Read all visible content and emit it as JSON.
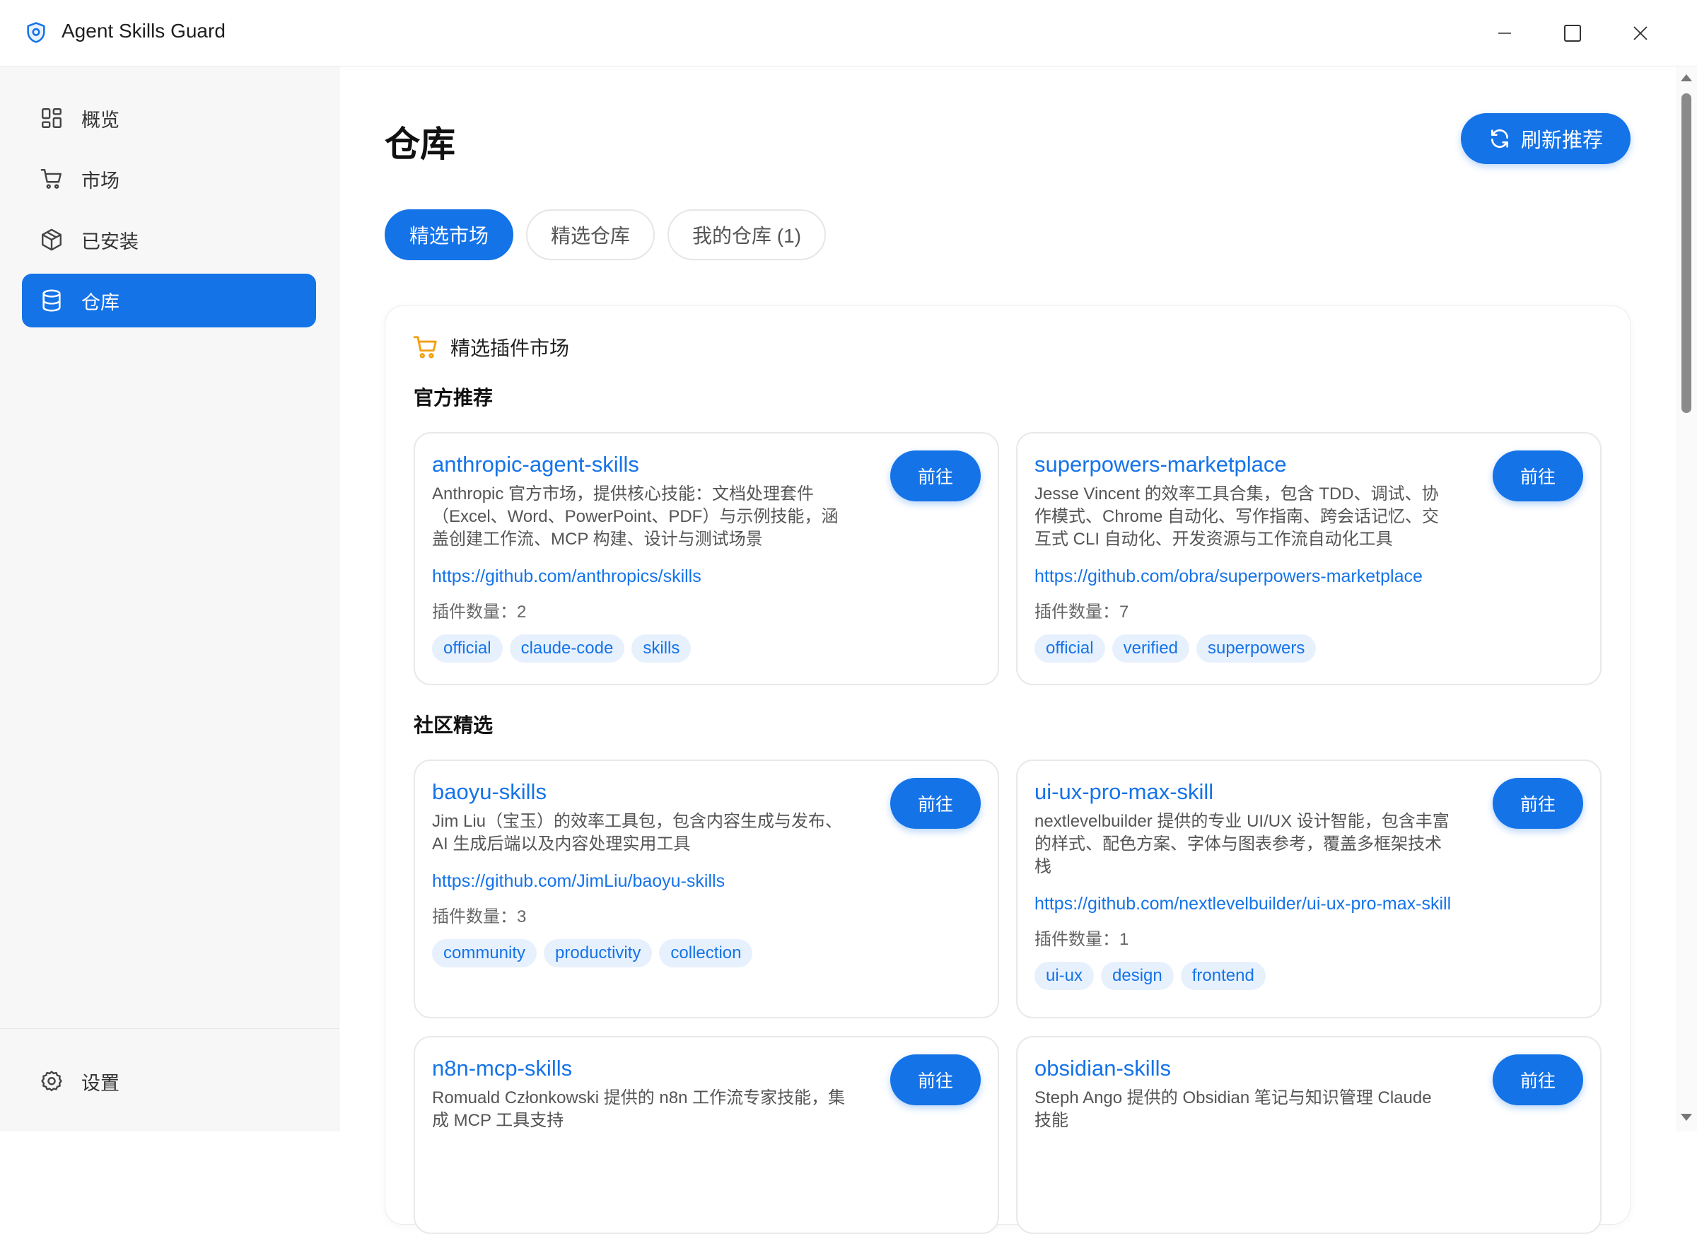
{
  "window": {
    "title": "Agent Skills Guard",
    "controls": [
      "minimize",
      "maximize",
      "close"
    ]
  },
  "sidebar": {
    "items": [
      {
        "label": "概览",
        "icon": "grid-icon"
      },
      {
        "label": "市场",
        "icon": "cart-icon"
      },
      {
        "label": "已安装",
        "icon": "package-icon"
      },
      {
        "label": "仓库",
        "icon": "database-icon",
        "active": true
      }
    ],
    "settings_label": "设置"
  },
  "page": {
    "title": "仓库",
    "refresh_label": "刷新推荐",
    "tabs": [
      {
        "label": "精选市场",
        "active": true
      },
      {
        "label": "精选仓库"
      },
      {
        "label": "我的仓库 (1)"
      }
    ]
  },
  "panel": {
    "header": "精选插件市场",
    "sections": [
      {
        "title": "官方推荐",
        "cards": [
          {
            "name": "anthropic-agent-skills",
            "desc": "Anthropic 官方市场，提供核心技能：文档处理套件（Excel、Word、PowerPoint、PDF）与示例技能，涵盖创建工作流、MCP 构建、设计与测试场景",
            "url": "https://github.com/anthropics/skills",
            "count": "插件数量：2",
            "tags": [
              "official",
              "claude-code",
              "skills"
            ],
            "button": "前往"
          },
          {
            "name": "superpowers-marketplace",
            "desc": "Jesse Vincent 的效率工具合集，包含 TDD、调试、协作模式、Chrome 自动化、写作指南、跨会话记忆、交互式 CLI 自动化、开发资源与工作流自动化工具",
            "url": "https://github.com/obra/superpowers-marketplace",
            "count": "插件数量：7",
            "tags": [
              "official",
              "verified",
              "superpowers"
            ],
            "button": "前往"
          }
        ]
      },
      {
        "title": "社区精选",
        "cards": [
          {
            "name": "baoyu-skills",
            "desc": "Jim Liu（宝玉）的效率工具包，包含内容生成与发布、AI 生成后端以及内容处理实用工具",
            "url": "https://github.com/JimLiu/baoyu-skills",
            "count": "插件数量：3",
            "tags": [
              "community",
              "productivity",
              "collection"
            ],
            "button": "前往"
          },
          {
            "name": "ui-ux-pro-max-skill",
            "desc": "nextlevelbuilder 提供的专业 UI/UX 设计智能，包含丰富的样式、配色方案、字体与图表参考，覆盖多框架技术栈",
            "url": "https://github.com/nextlevelbuilder/ui-ux-pro-max-skill",
            "count": "插件数量：1",
            "tags": [
              "ui-ux",
              "design",
              "frontend"
            ],
            "button": "前往"
          },
          {
            "name": "n8n-mcp-skills",
            "desc": "Romuald Członkowski 提供的 n8n 工作流专家技能，集成 MCP 工具支持",
            "button": "前往"
          },
          {
            "name": "obsidian-skills",
            "desc": "Steph Ango 提供的 Obsidian 笔记与知识管理 Claude 技能",
            "button": "前往"
          }
        ]
      }
    ]
  },
  "colors": {
    "accent": "#1573e8",
    "tag_bg": "#e7f1fd",
    "sidebar_bg": "#f7f7f8",
    "market_icon": "#f59e0b"
  }
}
